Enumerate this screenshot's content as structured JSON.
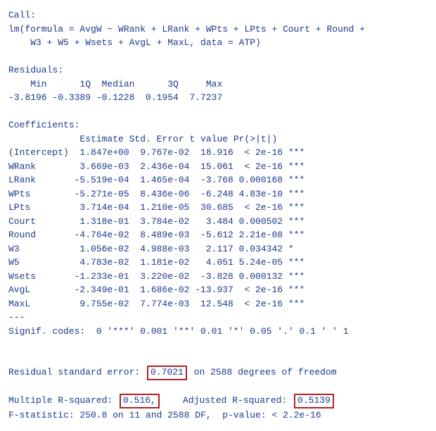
{
  "call": {
    "label": "Call:",
    "formula": "lm(formula = AvgW ~ WRank + LRank + WPts + LPts + Court + Round +\n    W3 + W5 + Wsets + AvgL + MaxL, data = ATP)"
  },
  "residuals": {
    "label": "Residuals:",
    "header": "    Min      1Q  Median      3Q     Max",
    "values": "-3.8196 -0.3389 -0.1228  0.1954  7.7237"
  },
  "coef": {
    "label": "Coefficients:",
    "header": "             Estimate Std. Error t value Pr(>|t|)",
    "rows": [
      {
        "name": "(Intercept)",
        "est": " 1.847e+00",
        "se": "9.767e-02",
        "t": " 18.916",
        "p": " < 2e-16",
        "sig": "***"
      },
      {
        "name": "WRank      ",
        "est": " 3.669e-03",
        "se": "2.436e-04",
        "t": " 15.061",
        "p": " < 2e-16",
        "sig": "***"
      },
      {
        "name": "LRank      ",
        "est": "-5.519e-04",
        "se": "1.465e-04",
        "t": " -3.768",
        "p": "0.000168",
        "sig": "***"
      },
      {
        "name": "WPts       ",
        "est": "-5.271e-05",
        "se": "8.436e-06",
        "t": " -6.248",
        "p": "4.83e-10",
        "sig": "***"
      },
      {
        "name": "LPts       ",
        "est": " 3.714e-04",
        "se": "1.210e-05",
        "t": " 30.685",
        "p": " < 2e-16",
        "sig": "***"
      },
      {
        "name": "Court      ",
        "est": " 1.318e-01",
        "se": "3.784e-02",
        "t": "  3.484",
        "p": "0.000502",
        "sig": "***"
      },
      {
        "name": "Round      ",
        "est": "-4.764e-02",
        "se": "8.489e-03",
        "t": " -5.612",
        "p": "2.21e-08",
        "sig": "***"
      },
      {
        "name": "W3         ",
        "est": " 1.056e-02",
        "se": "4.988e-03",
        "t": "  2.117",
        "p": "0.034342",
        "sig": "*"
      },
      {
        "name": "W5         ",
        "est": " 4.783e-02",
        "se": "1.181e-02",
        "t": "  4.051",
        "p": "5.24e-05",
        "sig": "***"
      },
      {
        "name": "Wsets      ",
        "est": "-1.233e-01",
        "se": "3.220e-02",
        "t": " -3.828",
        "p": "0.000132",
        "sig": "***"
      },
      {
        "name": "AvgL       ",
        "est": "-2.349e-01",
        "se": "1.686e-02",
        "t": "-13.937",
        "p": " < 2e-16",
        "sig": "***"
      },
      {
        "name": "MaxL       ",
        "est": " 9.755e-02",
        "se": "7.774e-03",
        "t": " 12.548",
        "p": " < 2e-16",
        "sig": "***"
      }
    ]
  },
  "sep": "---",
  "signif": "Signif. codes:  0 '***' 0.001 '**' 0.01 '*' 0.05 '.' 0.1 ' ' 1",
  "footer": {
    "rse_pre": "Residual standard error:",
    "rse_val": "0.7021",
    "rse_post": "on 2588 degrees of freedom",
    "r2_pre": "Multiple R-squared: ",
    "r2_val": "0.516,",
    "r2_mid": "    Adjusted R-squared: ",
    "adjr2_val": "0.5139",
    "fstat": "F-statistic: 250.8 on 11 and 2588 DF,  p-value: < 2.2e-16"
  }
}
